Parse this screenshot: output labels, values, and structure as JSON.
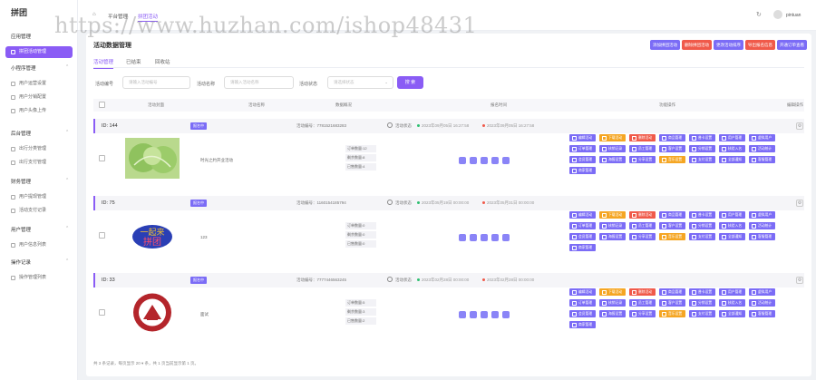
{
  "brand": "拼团",
  "watermark": "https://www.huzhan.com/ishop48431",
  "sidebar": {
    "groups": [
      {
        "label": "应用管理",
        "items": [
          {
            "label": "拼团活动管理",
            "active": true
          }
        ]
      },
      {
        "label": "小程序管理",
        "items": [
          {
            "label": "用户运营设置"
          },
          {
            "label": "用户分销配置"
          },
          {
            "label": "用户头像上传"
          }
        ]
      },
      {
        "label": "后台管理",
        "items": [
          {
            "label": "出行分类管理"
          },
          {
            "label": "出行支付管理"
          }
        ]
      },
      {
        "label": "财务管理",
        "items": [
          {
            "label": "用户提现管理"
          },
          {
            "label": "活动支付记录"
          }
        ]
      },
      {
        "label": "用户管理",
        "items": [
          {
            "label": "用户信息列表"
          }
        ]
      },
      {
        "label": "操作记录",
        "items": [
          {
            "label": "操作管理列表"
          }
        ]
      }
    ]
  },
  "topbar": {
    "home_icon": "⌂",
    "crumb1": "平台管理",
    "crumb2": "拼团活动",
    "refresh_icon": "↻",
    "user": "pintuan"
  },
  "page": {
    "title": "活动数据管理"
  },
  "toolbar": [
    {
      "label": "添加拼团活动",
      "color": "#7b6cf6"
    },
    {
      "label": "删除拼团活动",
      "color": "#f05a4a"
    },
    {
      "label": "更改活动排序",
      "color": "#7b6cf6"
    },
    {
      "label": "导出报名信息",
      "color": "#f05a4a"
    },
    {
      "label": "开通订单查看",
      "color": "#7b6cf6"
    }
  ],
  "tabs": [
    {
      "label": "活动管理",
      "active": true
    },
    {
      "label": "已结束"
    },
    {
      "label": "回收站"
    }
  ],
  "filters": {
    "id_label": "活动编号",
    "id_placeholder": "请输入活动编号",
    "name_label": "活动名称",
    "name_placeholder": "请输入活动名称",
    "status_label": "活动状态",
    "status_placeholder": "请选择状态",
    "search_label": "搜 索"
  },
  "table": {
    "headers": [
      "活动封面",
      "活动名称",
      "数据概况",
      "报名时间",
      "功能操作",
      "编辑操作"
    ]
  },
  "rows": [
    {
      "id": "ID: 144",
      "badge": "报名中",
      "sn": "活动编号：7781521683283",
      "state": "活动状态",
      "start": "2023年09月05日 16:27:58",
      "end": "2023年09月05日 16:27:58",
      "name": "时光之约开业活动",
      "thumb": "cabbage",
      "stats": [
        "订单数量:12",
        "剩余数量:8",
        "已售数量:4"
      ]
    },
    {
      "id": "ID: 75",
      "badge": "报名中",
      "sn": "活动编号：1160154185794",
      "state": "活动状态",
      "start": "2023年05月19日 00:00:00",
      "end": "2023年05月31日 00:00:00",
      "name": "123",
      "thumb": "logo",
      "stats": [
        "订单数量:0",
        "剩余数量:0",
        "已售数量:0"
      ]
    },
    {
      "id": "ID: 33",
      "badge": "报名中",
      "sn": "活动编号：7777446563245",
      "state": "活动状态",
      "start": "2023年02月28日 00:00:00",
      "end": "2023年02月28日 00:00:00",
      "name": "面试",
      "thumb": "seal",
      "stats": [
        "订单数量:5",
        "剩余数量:3",
        "已售数量:2"
      ]
    }
  ],
  "ops": [
    {
      "label": "编辑活动",
      "color": "#7b6cf6"
    },
    {
      "label": "下载活动",
      "color": "#f5a623"
    },
    {
      "label": "删除活动",
      "color": "#f05a4a"
    },
    {
      "label": "商品管理",
      "color": "#7b6cf6"
    },
    {
      "label": "普卡设置",
      "color": "#7b6cf6"
    },
    {
      "label": "用户管理",
      "color": "#7b6cf6"
    },
    {
      "label": "虚拟用户",
      "color": "#7b6cf6"
    },
    {
      "label": "订单管理",
      "color": "#7b6cf6"
    },
    {
      "label": "核销记录",
      "color": "#7b6cf6"
    },
    {
      "label": "员工管理",
      "color": "#7b6cf6"
    },
    {
      "label": "客户设置",
      "color": "#7b6cf6"
    },
    {
      "label": "分销设置",
      "color": "#7b6cf6"
    },
    {
      "label": "核验入名",
      "color": "#7b6cf6"
    },
    {
      "label": "活动统计",
      "color": "#7b6cf6"
    },
    {
      "label": "会员管理",
      "color": "#7b6cf6"
    },
    {
      "label": "海报设置",
      "color": "#7b6cf6"
    },
    {
      "label": "分享设置",
      "color": "#7b6cf6"
    },
    {
      "label": "音乐设置",
      "color": "#f5a623"
    },
    {
      "label": "支付设置",
      "color": "#7b6cf6"
    },
    {
      "label": "全部通知",
      "color": "#7b6cf6"
    },
    {
      "label": "客服管理",
      "color": "#7b6cf6"
    },
    {
      "label": "商家管理",
      "color": "#7b6cf6"
    }
  ],
  "footer": "共 3 条记录，每页显示 20 ▾ 条，共 1 页当前显示第 1 页。"
}
